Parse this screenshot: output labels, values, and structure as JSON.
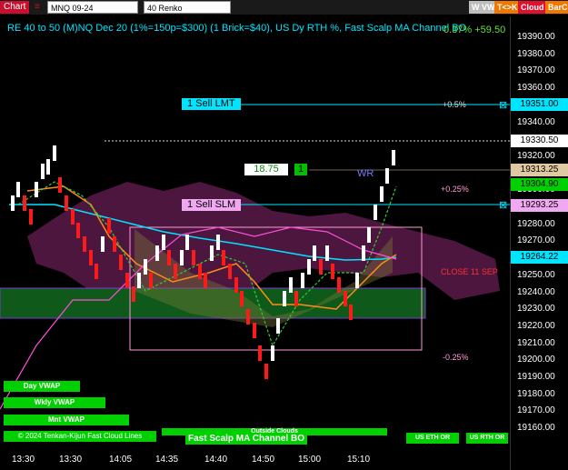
{
  "topbar": {
    "chart_tab": "Chart",
    "instrument": "MNQ 09-24",
    "bar_type": "40 Renko",
    "buttons": [
      "W VWAP",
      "T<>K",
      "Cloud",
      "BarCo"
    ]
  },
  "chart": {
    "title": "RE 40 to 50 (M)NQ Dec 20 (1%=150p=$300) (1 Brick=$40), US Dy RTH %, Fast Scalp MA Channel BO",
    "title_value": "0.37% +59.50",
    "y_axis_ticks": [
      "19390.00",
      "19380.00",
      "19370.00",
      "19360.00",
      "19350.00",
      "19340.00",
      "19330.00",
      "19320.00",
      "19310.00",
      "19300.00",
      "19290.00",
      "19280.00",
      "19270.00",
      "19260.00",
      "19250.00",
      "19240.00",
      "19230.00",
      "19220.00",
      "19210.00",
      "19200.00",
      "19190.00",
      "19180.00",
      "19170.00",
      "19160.00"
    ],
    "x_axis_ticks": [
      "13:30",
      "13:30",
      "14:05",
      "14:35",
      "14:40",
      "14:50",
      "15:00",
      "15:10"
    ],
    "price_tags": [
      {
        "text": "19351.00",
        "bg": "#00e5ff",
        "fg": "#000000"
      },
      {
        "text": "19330.50",
        "bg": "#ffffff",
        "fg": "#000000"
      },
      {
        "text": "19313.25",
        "bg": "#e0c8a0",
        "fg": "#000000"
      },
      {
        "text": "19304.90",
        "bg": "#00d000",
        "fg": "#000000"
      },
      {
        "text": "19293.25",
        "bg": "#f0a8f0",
        "fg": "#000000"
      },
      {
        "text": "19264.22",
        "bg": "#00e5ff",
        "fg": "#000000"
      }
    ],
    "orders": {
      "sell_lmt": "1 Sell LMT",
      "sell_slm": "1 Sell SLM",
      "position_price": "18.75",
      "position_qty": "1"
    },
    "labels": {
      "plus_half": "+0.5%",
      "plus_quarter": "+0.25%",
      "minus_quarter": "-0.25%",
      "close_label": "CLOSE 11 SEP",
      "wr_label": "WR",
      "outside_clouds": "Outside Clouds",
      "fast_scalp": "Fast Scalp MA Channel BO",
      "copyright": "© 2024 Tenkan-Kijun Fast Cloud Lines"
    },
    "side_buttons": [
      "Day VWAP",
      "Wkly VWAP",
      "Mnt VWAP"
    ],
    "bottom_buttons": [
      "US ETH OR",
      "US RTH OR"
    ],
    "colors": {
      "up_brick": "#ffffff",
      "down_brick": "#ff1a1a",
      "ma_cyan": "#00e5ff",
      "cloud": "#5a1a4a",
      "band_green": "#0f5a1a"
    }
  }
}
